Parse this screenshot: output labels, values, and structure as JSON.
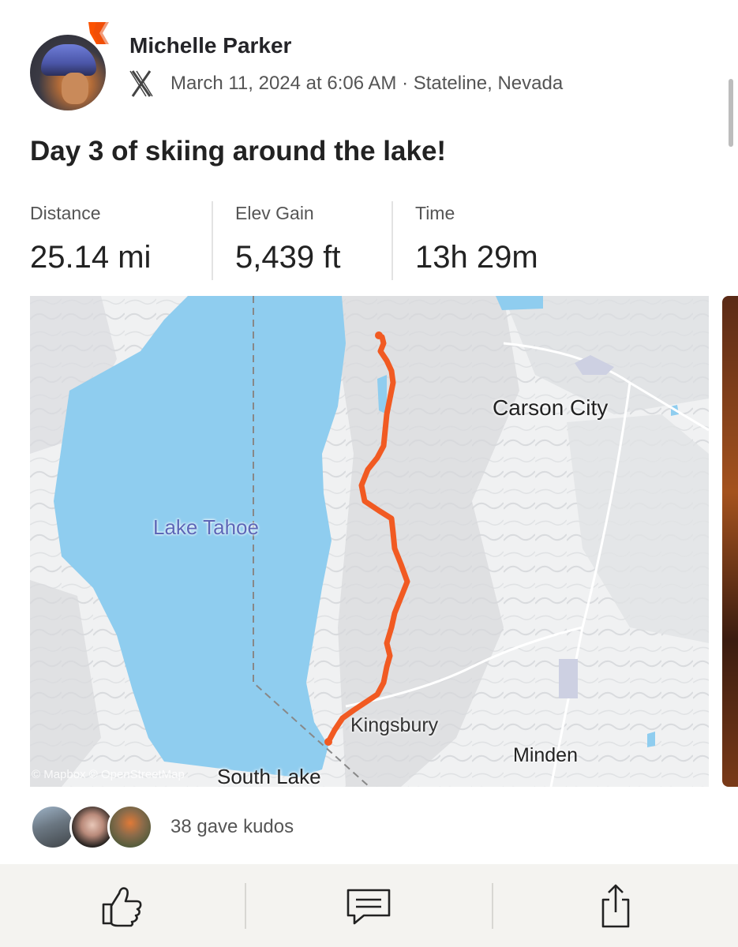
{
  "post": {
    "author": "Michelle Parker",
    "meta": "March 11, 2024 at 6:06 AM · Stateline, Nevada",
    "title": "Day 3 of skiing around the lake!"
  },
  "stats": [
    {
      "label": "Distance",
      "value": "25.14 mi"
    },
    {
      "label": "Elev Gain",
      "value": "5,439 ft"
    },
    {
      "label": "Time",
      "value": "13h 29m"
    }
  ],
  "map": {
    "labels": {
      "lake": "Lake Tahoe",
      "carson_city": "Carson City",
      "kingsbury": "Kingsbury",
      "minden": "Minden",
      "south_lake": "South Lake"
    },
    "attribution": "© Mapbox © OpenStreetMap",
    "colors": {
      "water": "#8fcdef",
      "route": "#f15a22",
      "land": "#f1f2f3"
    }
  },
  "kudos": {
    "text": "38 gave kudos"
  },
  "icons": {
    "badge": "strava-chevron-icon",
    "device": "x-device-icon",
    "like": "thumbs-up-icon",
    "comment": "comment-icon",
    "share": "share-icon"
  },
  "colors": {
    "brand": "#fc5200",
    "actionbar": "#f4f3f0"
  }
}
